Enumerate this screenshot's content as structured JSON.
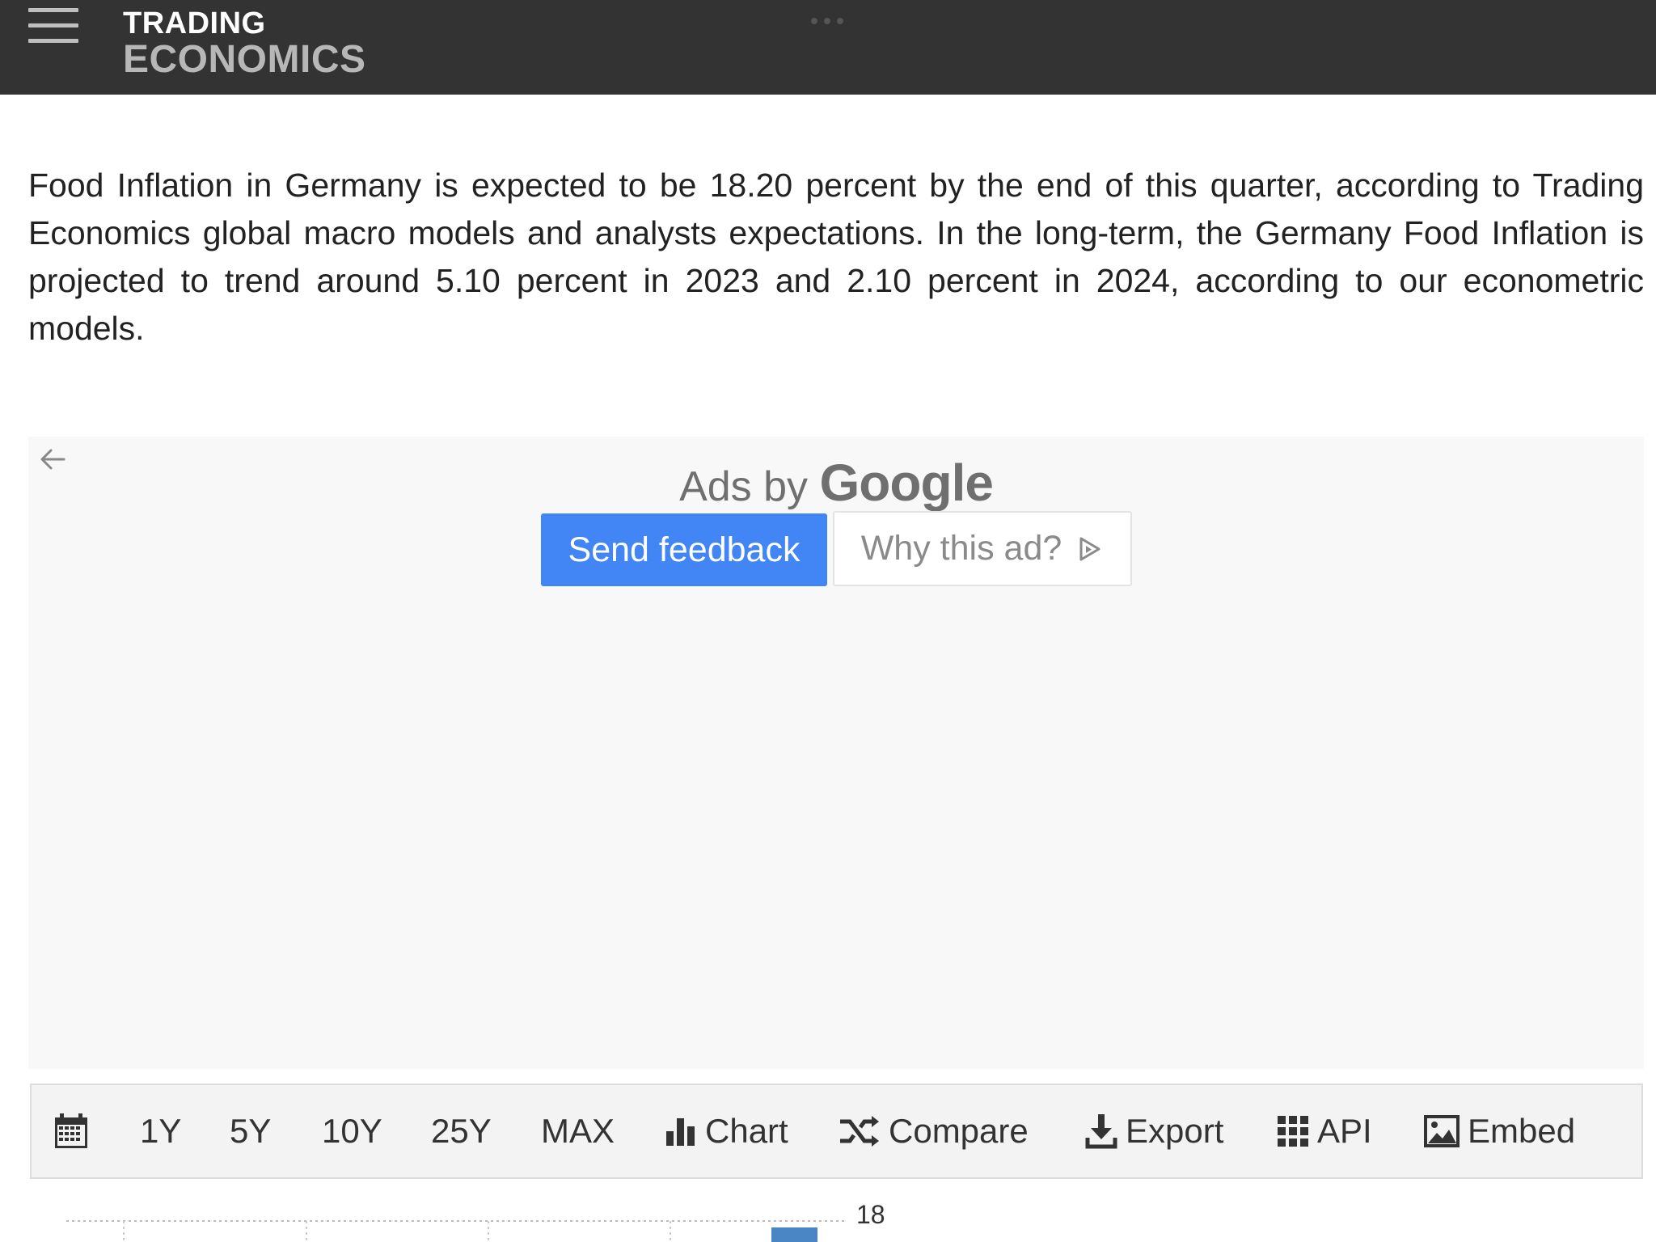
{
  "header": {
    "logo_line1": "TRADING",
    "logo_line2": "ECONOMICS",
    "bg_color": "#333333"
  },
  "description": "Food Inflation in Germany is expected to be 18.20 percent by the end of this quarter, according to Trading Economics global macro models and analysts expectations. In the long-term, the Germany Food Inflation is projected to trend around 5.10 percent in 2023 and 2.10 percent in 2024, according to our econometric models.",
  "ad": {
    "ads_by": "Ads by",
    "google": "Google",
    "send_feedback": "Send feedback",
    "why_this_ad": "Why this ad?",
    "send_feedback_color": "#4285f4"
  },
  "toolbar": {
    "ranges": [
      "1Y",
      "5Y",
      "10Y",
      "25Y",
      "MAX"
    ],
    "chart": "Chart",
    "compare": "Compare",
    "export": "Export",
    "api": "API",
    "embed": "Embed"
  },
  "chart_preview": {
    "y_tick_label": "18",
    "bar_color": "#4a86c5"
  },
  "icons": [
    "menu-icon",
    "back-arrow-icon",
    "ad-choices-icon",
    "calendar-icon",
    "bar-chart-icon",
    "shuffle-icon",
    "download-icon",
    "grid-icon",
    "image-icon"
  ]
}
